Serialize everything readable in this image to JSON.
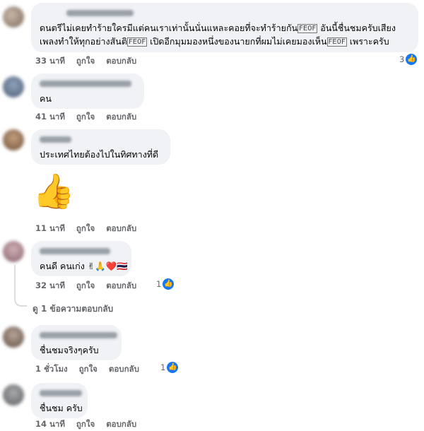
{
  "labels": {
    "like": "ถูกใจ",
    "reply": "ตอบกลับ"
  },
  "comments": [
    {
      "line1_a": "ดนตรีไม่เคยทำร้ายใครมีแต่คนเราเท่านั้นนั่นแหละคอยที่จะทำร้ายกัน",
      "line1_box": "🙏",
      "line1_b": " อันนี้ชื่นชมครับเสียง",
      "line2_a": "เพลงทำให้ทุกอย่างสันติ",
      "line2_box1": "🙏",
      "line2_b": " เปิดอีกมุมมองหนึ่งของนายกที่ผมไม่เคยมองเห็น",
      "line2_box2": "🙏",
      "line2_c": " เพราะครับ",
      "time": "33 นาที",
      "reactions": "3"
    },
    {
      "text": "คน",
      "time": "41 นาที"
    },
    {
      "text": "ประเทศไทยต้องไปในทิศทางที่ดี",
      "sticker": "👍",
      "time": "11 นาที"
    },
    {
      "text": "คนดี คนเก่ง ✌🙏❤️🇹🇭",
      "time": "32 นาที",
      "reactions": "1"
    },
    {
      "text": "ชื่นชมจริงๆครับ",
      "time": "1 ชั่วโมง",
      "reactions": "1"
    },
    {
      "text": "ชื่นชม ครับ",
      "time": "14 นาที"
    }
  ],
  "view_replies": "ดู 1 ข้อความตอบกลับ",
  "colors": {
    "bubble": "#f0f2f5",
    "meta": "#65676b",
    "like_blue": "#1877f2",
    "line": "#dadde1"
  }
}
